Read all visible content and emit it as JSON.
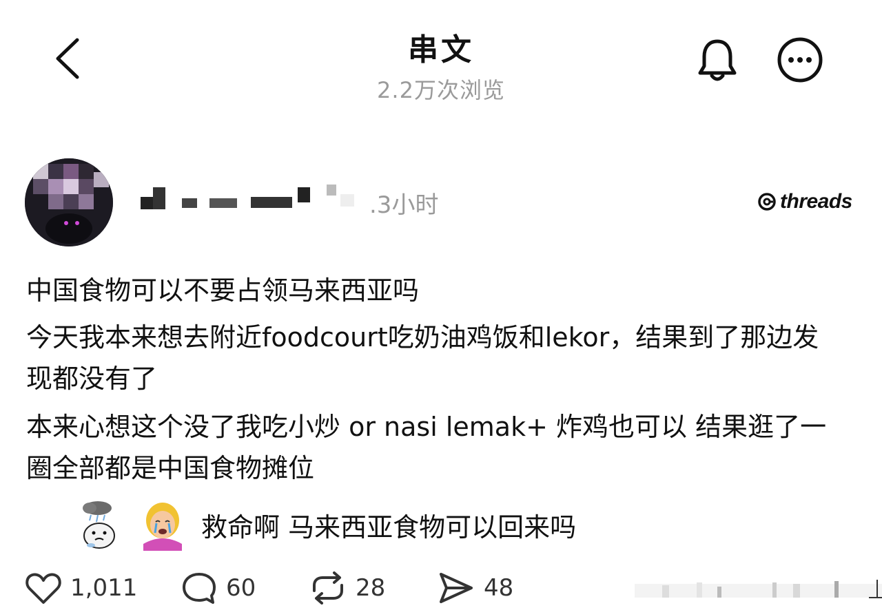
{
  "header": {
    "title": "串文",
    "views": "2.2万次浏览",
    "back_icon": "chevron-left-icon",
    "bell_icon": "bell-icon",
    "more_icon": "more-horizontal-icon"
  },
  "author": {
    "time": ".3小时",
    "platform": "threads"
  },
  "post": {
    "lines": [
      "中国食物可以不要占领马来西亚吗",
      "今天我本来想去附近foodcourt吃奶油鸡饭和lekor，结果到了那边发现都没有了",
      "本来心想这个没了我吃小炒 or nasi lemak+ 炸鸡也可以 结果逛了一圈全部都是中国食物摊位"
    ],
    "emoji_line": "救命啊 马来西亚食物可以回来吗"
  },
  "actions": {
    "likes": "1,011",
    "comments": "60",
    "reposts": "28",
    "shares": "48"
  },
  "colors": {
    "text": "#111111",
    "muted": "#9a9a9a"
  }
}
